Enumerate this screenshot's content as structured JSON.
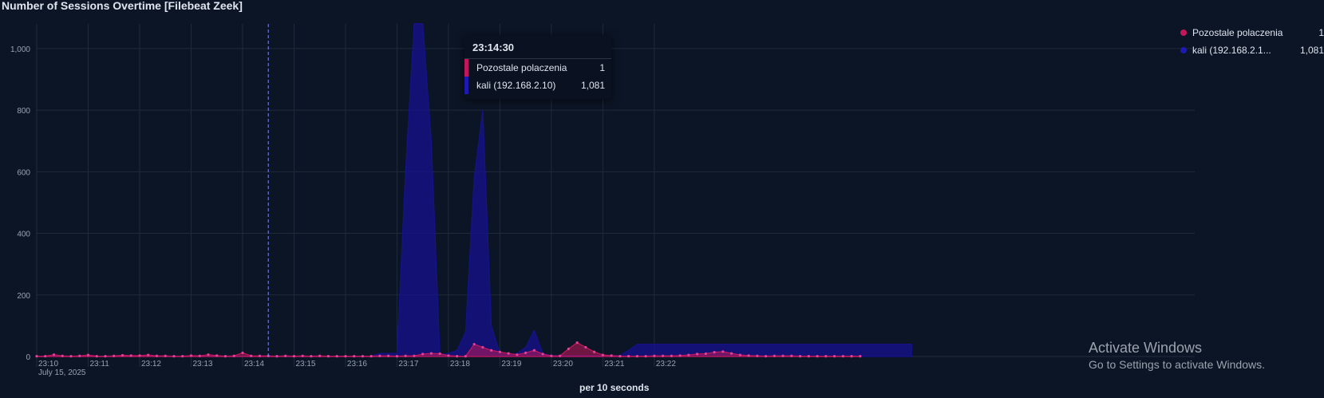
{
  "title": "Number of Sessions Overtime [Filebeat Zeek]",
  "chart_data": {
    "type": "area",
    "x_start": "23:10:00",
    "x_interval_seconds": 10,
    "date_label": "July 15, 2025",
    "xlabel": "per 10 seconds",
    "ylabel": "",
    "ylim": [
      0,
      1080
    ],
    "y_ticks": [
      0,
      200,
      400,
      600,
      800,
      1000
    ],
    "y_tick_labels": [
      "0",
      "200",
      "400",
      "600",
      "800",
      "1,000"
    ],
    "x_tick_labels": [
      "23:10",
      "23:11",
      "23:12",
      "23:13",
      "23:14",
      "23:15",
      "23:16",
      "23:17",
      "23:18",
      "23:19",
      "23:20",
      "23:21",
      "23:22"
    ],
    "grid": true,
    "legend_position": "top-right",
    "series": [
      {
        "name": "Pozostale polaczenia",
        "color": "#c2185b",
        "values": [
          1,
          1,
          6,
          2,
          1,
          2,
          5,
          1,
          1,
          2,
          4,
          3,
          3,
          5,
          2,
          2,
          1,
          1,
          3,
          2,
          6,
          3,
          1,
          2,
          12,
          2,
          2,
          2,
          1,
          2,
          1,
          2,
          1,
          2,
          1,
          1,
          1,
          1,
          1,
          1,
          2,
          2,
          1,
          2,
          2,
          8,
          10,
          9,
          3,
          1,
          1,
          40,
          30,
          20,
          15,
          10,
          6,
          12,
          20,
          8,
          2,
          2,
          25,
          45,
          30,
          15,
          5,
          3,
          1,
          1,
          1,
          1,
          2,
          2,
          2,
          3,
          5,
          8,
          9,
          14,
          16,
          10,
          5,
          3,
          2,
          1,
          2,
          2,
          2,
          1,
          1,
          1,
          1,
          1,
          1,
          1,
          1
        ]
      },
      {
        "name": "kali (192.168.2.10)",
        "color": "#16128a",
        "values": [
          1,
          1,
          1,
          1,
          1,
          1,
          1,
          1,
          1,
          1,
          1,
          1,
          1,
          1,
          1,
          1,
          1,
          1,
          1,
          1,
          1,
          1,
          1,
          1,
          1,
          1,
          1,
          1,
          1,
          1,
          1,
          1,
          1,
          1,
          1,
          1,
          1,
          1,
          1,
          1,
          10,
          10,
          10,
          600,
          1081,
          1081,
          700,
          5,
          10,
          20,
          80,
          580,
          800,
          100,
          10,
          5,
          10,
          30,
          85,
          10,
          3,
          3,
          3,
          3,
          3,
          3,
          3,
          3,
          3,
          20,
          40,
          40,
          40,
          40,
          40,
          40,
          40,
          40,
          40,
          40,
          40,
          40,
          40,
          40,
          40,
          40,
          40,
          40,
          40,
          40,
          40,
          40,
          40,
          40,
          40,
          40,
          40,
          40,
          40,
          40,
          40,
          40,
          40
        ]
      }
    ],
    "tooltip": {
      "time": "23:14:30",
      "rows": [
        {
          "label": "Pozostale polaczenia",
          "value": "1",
          "color": "#c2185b"
        },
        {
          "label": "kali (192.168.2.10)",
          "value": "1,081",
          "color": "#1e1ab0"
        }
      ]
    }
  },
  "legend": [
    {
      "label": "Pozostale polaczenia",
      "value": "1",
      "color": "#c2185b"
    },
    {
      "label": "kali (192.168.2.1...",
      "value": "1,081",
      "color": "#1e1ab0"
    }
  ],
  "watermark": {
    "line1": "Activate Windows",
    "line2": "Go to Settings to activate Windows."
  }
}
